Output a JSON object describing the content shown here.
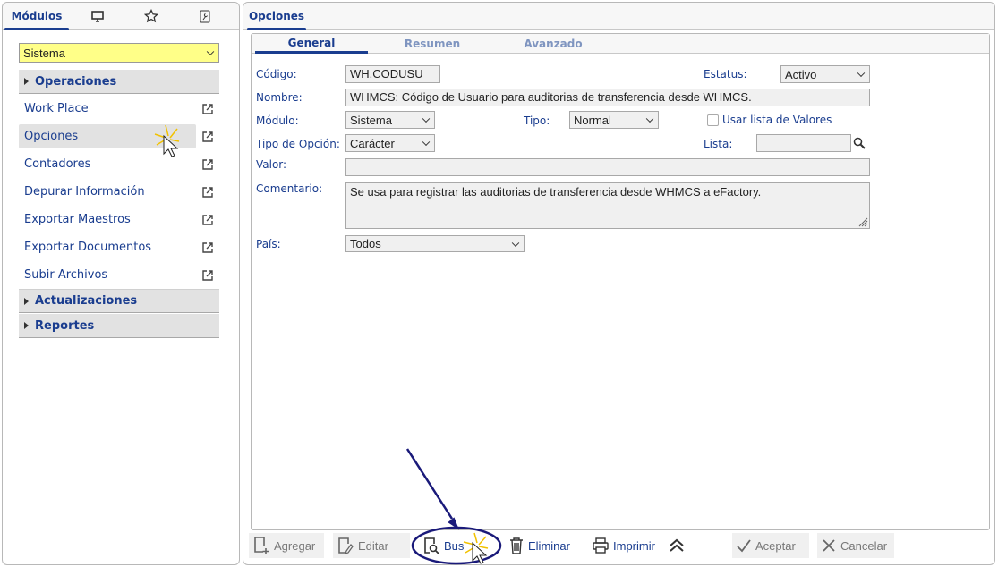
{
  "left_panel": {
    "tabs": [
      {
        "label": "Módulos",
        "active": true
      },
      {
        "icon": "monitor-icon"
      },
      {
        "icon": "star-icon"
      },
      {
        "icon": "wrench-icon"
      }
    ],
    "module_select": {
      "value": "Sistema",
      "highlight_color": "#ffff88"
    },
    "groups": [
      {
        "label": "Operaciones",
        "expanded": true
      },
      {
        "label": "Actualizaciones"
      },
      {
        "label": "Reportes"
      }
    ],
    "items": [
      {
        "label": "Work Place"
      },
      {
        "label": "Opciones",
        "selected": true
      },
      {
        "label": "Contadores"
      },
      {
        "label": "Depurar Información"
      },
      {
        "label": "Exportar Maestros"
      },
      {
        "label": "Exportar Documentos"
      },
      {
        "label": "Subir Archivos"
      }
    ]
  },
  "right_panel": {
    "tab": "Opciones",
    "form_tabs": [
      {
        "label": "General",
        "active": true
      },
      {
        "label": "Resumen"
      },
      {
        "label": "Avanzado"
      }
    ],
    "fields": {
      "codigo": {
        "label": "Código:",
        "value": "WH.CODUSU"
      },
      "estatus": {
        "label": "Estatus:",
        "value": "Activo"
      },
      "nombre": {
        "label": "Nombre:",
        "value": "WHMCS: Código de Usuario para auditorias de transferencia desde WHMCS."
      },
      "modulo": {
        "label": "Módulo:",
        "value": "Sistema"
      },
      "tipo": {
        "label": "Tipo:",
        "value": "Normal"
      },
      "usar_lista": {
        "label": "Usar lista de Valores",
        "checked": false
      },
      "tipo_opcion": {
        "label": "Tipo de Opción:",
        "value": "Carácter"
      },
      "lista": {
        "label": "Lista:",
        "value": ""
      },
      "valor": {
        "label": "Valor:",
        "value": ""
      },
      "comentario": {
        "label": "Comentario:",
        "value": "Se usa para registrar las auditorias de transferencia desde WHMCS a eFactory."
      },
      "pais": {
        "label": "País:",
        "value": "Todos"
      }
    },
    "toolbar": {
      "agregar": "Agregar",
      "editar": "Editar",
      "buscar": "Bus",
      "eliminar": "Eliminar",
      "imprimir": "Imprimir",
      "aceptar": "Aceptar",
      "cancelar": "Cancelar"
    }
  },
  "accent_color": "#1a3d8f"
}
